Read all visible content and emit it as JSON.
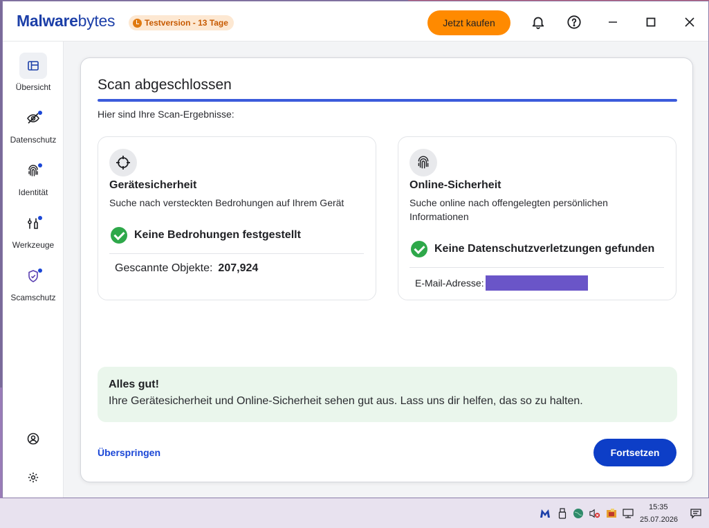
{
  "app": {
    "brand_bold": "Malware",
    "brand_light": "bytes",
    "trial_badge": "Testversion - 13 Tage",
    "buy_label": "Jetzt kaufen"
  },
  "sidebar": {
    "items": [
      {
        "label": "Übersicht",
        "icon": "overview-icon",
        "active": true,
        "dot": false
      },
      {
        "label": "Datenschutz",
        "icon": "eye-slash-icon",
        "active": false,
        "dot": true
      },
      {
        "label": "Identität",
        "icon": "fingerprint-icon",
        "active": false,
        "dot": true
      },
      {
        "label": "Werkzeuge",
        "icon": "tools-icon",
        "active": false,
        "dot": true
      },
      {
        "label": "Scamschutz",
        "icon": "shield-icon",
        "active": false,
        "dot": true
      }
    ]
  },
  "main": {
    "title": "Scan abgeschlossen",
    "progress_percent": 100,
    "subtitle": "Hier sind Ihre Scan-Ergebnisse:",
    "device": {
      "title": "Gerätesicherheit",
      "description": "Suche nach versteckten Bedrohungen auf Ihrem Gerät",
      "status": "Keine Bedrohungen festgestellt",
      "scanned_label": "Gescannte Objekte:",
      "scanned_value": "207,924"
    },
    "online": {
      "title": "Online-Sicherheit",
      "description": "Suche online nach offengelegten persönlichen Informationen",
      "status": "Keine Datenschutzverletzungen gefunden",
      "email_label": "E-Mail-Adresse:"
    },
    "summary": {
      "title": "Alles gut!",
      "text": "Ihre Gerätesicherheit und Online-Sicherheit sehen gut aus. Lass uns dir helfen, das so zu halten."
    },
    "skip_label": "Überspringen",
    "continue_label": "Fortsetzen"
  },
  "taskbar": {
    "time": "15:35",
    "date": "25.07.2026"
  },
  "colors": {
    "brand": "#1c3fa8",
    "accent_orange": "#ff8a00",
    "primary_button": "#0d3ec7",
    "success_green": "#2ea84a",
    "progress_blue": "#3b5bdb"
  }
}
